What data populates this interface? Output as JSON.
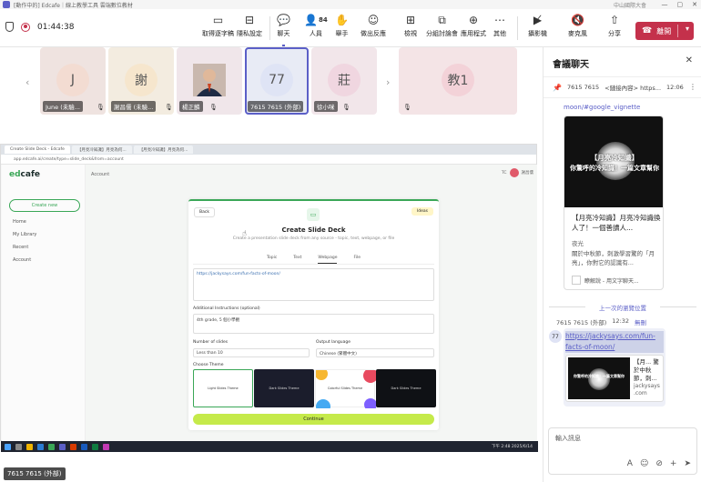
{
  "window": {
    "title": "[動作中的] Edcafe｜線上教學工具 雲端數位教材",
    "right_text": "中山國際大會"
  },
  "toolbar": {
    "timer": "01:44:38",
    "buttons": [
      {
        "label": "取得逐字稿",
        "icon": "transcript-icon"
      },
      {
        "label": "隱私設定",
        "icon": "share-tray-icon"
      },
      {
        "label": "聊天",
        "icon": "chat-icon"
      },
      {
        "label": "人員",
        "icon": "people-icon",
        "count": "84"
      },
      {
        "label": "舉手",
        "icon": "raise-hand-icon"
      },
      {
        "label": "做出反應",
        "icon": "react-icon"
      },
      {
        "label": "檢視",
        "icon": "view-icon"
      },
      {
        "label": "分組討論會",
        "icon": "rooms-icon"
      },
      {
        "label": "應用程式",
        "icon": "apps-icon"
      },
      {
        "label": "其他",
        "icon": "more-icon"
      },
      {
        "label": "攝影機",
        "icon": "camera-off-icon"
      },
      {
        "label": "麥克風",
        "icon": "mic-off-icon"
      },
      {
        "label": "分享",
        "icon": "share-icon"
      }
    ],
    "leave_label": "離開"
  },
  "participants": [
    {
      "initial": "J",
      "name": "June (未驗...",
      "bg": "#efe3e0",
      "avbg": "#f3dcd2"
    },
    {
      "initial": "謝",
      "name": "謝昌儒 (未驗...",
      "bg": "#f3ece0",
      "avbg": "#f6e6cd"
    },
    {
      "initial": "",
      "name": "楊正麟",
      "bg": "#f0e6ea",
      "avbg": "#6a5050"
    },
    {
      "initial": "77",
      "name": "7615 7615 (外部)",
      "bg": "#e8ebf5",
      "avbg": "#dfe4f5"
    },
    {
      "initial": "莊",
      "name": "徐小咪",
      "bg": "#f2e6ea",
      "avbg": "#f0d6e0"
    },
    {
      "initial": "教1",
      "name": "",
      "bg": "#f4e4e6",
      "avbg": "#f3d2d8"
    }
  ],
  "shared": {
    "tabs": [
      "Create Slide Deck - Edcafe",
      "【月亮冷知識】月亮為何...",
      "【月亮冷知識】月亮為何..."
    ],
    "address": "app.edcafe.ai/create/type=slide_deck&from=account",
    "logo_a": "ed",
    "logo_b": "cafe",
    "create_new": "Create new",
    "nav": [
      "Home",
      "My Library",
      "Recent",
      "Account"
    ],
    "account_label": "Account",
    "user_initials": "TC",
    "user_name": "謝昌儒",
    "modal": {
      "back": "Back",
      "ideas": "Ideas",
      "title": "Create Slide Deck",
      "subtitle": "Create a presentation slide deck from any source - topic, text, webpage, or file",
      "tabs": [
        "Topic",
        "Text",
        "Webpage",
        "File"
      ],
      "url_value": "https://jackysays.com/fun-facts-of-moon/",
      "additional_label": "Additional Instructions (optional)",
      "additional_value": "4th grade, 5 個小學觀",
      "slides_label": "Number of slides",
      "slides_value": "Less than 10",
      "language_label": "Output language",
      "language_value": "Chinese (繁體中文)",
      "theme_label": "Choose Theme",
      "themes": [
        "Light Slides Theme",
        "Dark Slides Theme",
        "Colorful Slides Theme",
        "Dark Slides Theme"
      ],
      "continue": "Continue"
    },
    "clock": "下午 2:48\n2025/6/14",
    "presenter": "7615 7615 (外部)"
  },
  "chat": {
    "title": "會議聊天",
    "pinned": {
      "sender": "7615 7615",
      "text": "<鏈接內容> https...",
      "time": "12:06"
    },
    "link_top": "moon/#google_vignette",
    "card": {
      "img_caption1": "【月亮冷知識】",
      "img_caption2": "你驚呼的冷知識！一篇文章幫你",
      "title": "【月亮冷知識】月亮冷知識換人了！一個善讀人...",
      "source": "夜光",
      "desc": "關於中秋節，刺激學習驚的「月亮」，你對它的認識有...",
      "footer": "瞭解說 - 用文字聊天..."
    },
    "prev_marker": "上一次的瀏覽位置",
    "msg": {
      "sender": "7615 7615 (外部)",
      "time": "12:32",
      "edited": "無刪",
      "avatar": "77",
      "link": "https://jackysays.com/fun-facts-of-moon/",
      "mini_caption": "你驚呼的冷知識！一篇文章幫你",
      "mini_title": "【月... 驚於中秋節，刺...",
      "mini_source": "jackysays .com"
    },
    "compose_placeholder": "輸入訊息"
  }
}
